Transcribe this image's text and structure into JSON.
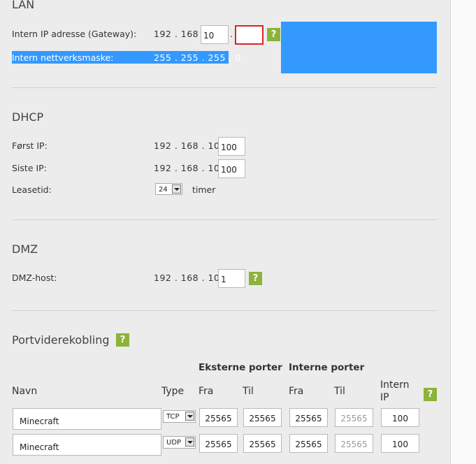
{
  "lan": {
    "title": "LAN",
    "gateway_label": "Intern IP adresse (Gateway):",
    "gateway_prefix": "192 . 168 .",
    "gateway_octet3": "10",
    "dot": ".",
    "gateway_octet4": "",
    "netmask_label": "Intern nettverksmaske:",
    "netmask_value": "255 . 255 . 255 . 0"
  },
  "dhcp": {
    "title": "DHCP",
    "first_label": "Først IP:",
    "first_prefix": "192 . 168 . 10 .",
    "first_value": "100",
    "last_label": "Siste IP:",
    "last_prefix": "192 . 168 . 10 .",
    "last_value": "100",
    "lease_label": "Leasetid:",
    "lease_value": "24",
    "lease_unit": "timer"
  },
  "dmz": {
    "title": "DMZ",
    "host_label": "DMZ-host:",
    "host_prefix": "192 . 168 . 10 .",
    "host_value": "1"
  },
  "port": {
    "title": "Portviderekobling",
    "ext_header": "Eksterne porter",
    "int_header": "Interne porter",
    "col_navn": "Navn",
    "col_type": "Type",
    "col_fra1": "Fra",
    "col_til1": "Til",
    "col_fra2": "Fra",
    "col_til2": "Til",
    "col_ip_1": "Intern",
    "col_ip_2": "IP",
    "rows": [
      {
        "name": "Minecraft",
        "type": "TCP",
        "ext_from": "25565",
        "ext_to": "25565",
        "int_from": "25565",
        "int_to": "25565",
        "ip": "100"
      },
      {
        "name": "Minecraft",
        "type": "UDP",
        "ext_from": "25565",
        "ext_to": "25565",
        "int_from": "25565",
        "int_to": "25565",
        "ip": "100"
      }
    ]
  },
  "help_glyph": "?",
  "colors": {
    "selection": "#3399ff",
    "help": "#8cb33a",
    "error": "#dd2222"
  }
}
